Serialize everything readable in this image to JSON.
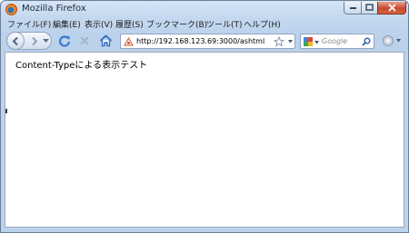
{
  "window": {
    "title": "Mozilla Firefox"
  },
  "menu": {
    "items": [
      "ファイル(F)",
      "編集(E)",
      "表示(V)",
      "履歴(S)",
      "ブックマーク(B)",
      "ツール(T)",
      "ヘルプ(H)"
    ]
  },
  "navbar": {
    "url": "http://192.168.123.69:3000/ashtml",
    "search_placeholder": "Google"
  },
  "page": {
    "text": "Content-Typeによる表示テスト"
  }
}
